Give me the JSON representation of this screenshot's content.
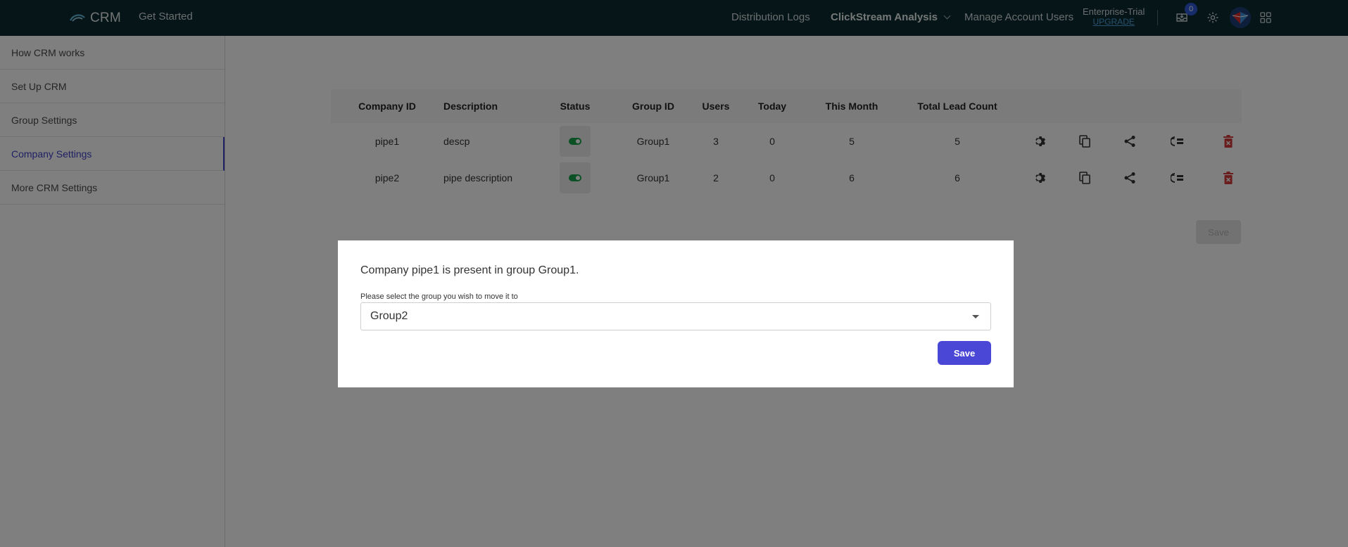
{
  "topbar": {
    "brand": "CRM",
    "get_started": "Get Started",
    "nav": {
      "distribution_logs": "Distribution Logs",
      "clickstream_analysis": "ClickStream Analysis",
      "manage_account_users": "Manage Account Users"
    },
    "plan": {
      "name": "Enterprise-Trial",
      "upgrade": "UPGRADE"
    },
    "notification_count": "0",
    "icons": [
      "inbox-icon",
      "settings-icon",
      "avatar",
      "apps-grid-icon"
    ]
  },
  "sidebar": {
    "items": [
      {
        "label": "How CRM works"
      },
      {
        "label": "Set Up CRM"
      },
      {
        "label": "Group Settings"
      },
      {
        "label": "Company Settings",
        "active": true
      },
      {
        "label": "More CRM Settings"
      }
    ]
  },
  "table": {
    "headers": [
      "Company ID",
      "Description",
      "Status",
      "Group ID",
      "Users",
      "Today",
      "This Month",
      "Total Lead Count"
    ],
    "rows": [
      {
        "company_id": "pipe1",
        "description": "descp",
        "status": "on",
        "group_id": "Group1",
        "users": "3",
        "today": "0",
        "this_month": "5",
        "total_lead_count": "5"
      },
      {
        "company_id": "pipe2",
        "description": "pipe description",
        "status": "on",
        "group_id": "Group1",
        "users": "2",
        "today": "0",
        "this_month": "6",
        "total_lead_count": "6"
      }
    ],
    "row_actions": [
      "settings-icon",
      "copy-icon",
      "share-icon",
      "move-group-icon",
      "delete-icon"
    ],
    "save_label": "Save"
  },
  "modal": {
    "message": "Company pipe1 is present in group Group1.",
    "select_label": "Please select the group you wish to move it to",
    "selected_group": "Group2",
    "save_label": "Save"
  },
  "colors": {
    "topbar": "#0c2a2e",
    "accent": "#4b47d6",
    "active_sidebar": "#3f3fc8",
    "status_on": "#17a34a",
    "delete": "#d33a3a"
  }
}
